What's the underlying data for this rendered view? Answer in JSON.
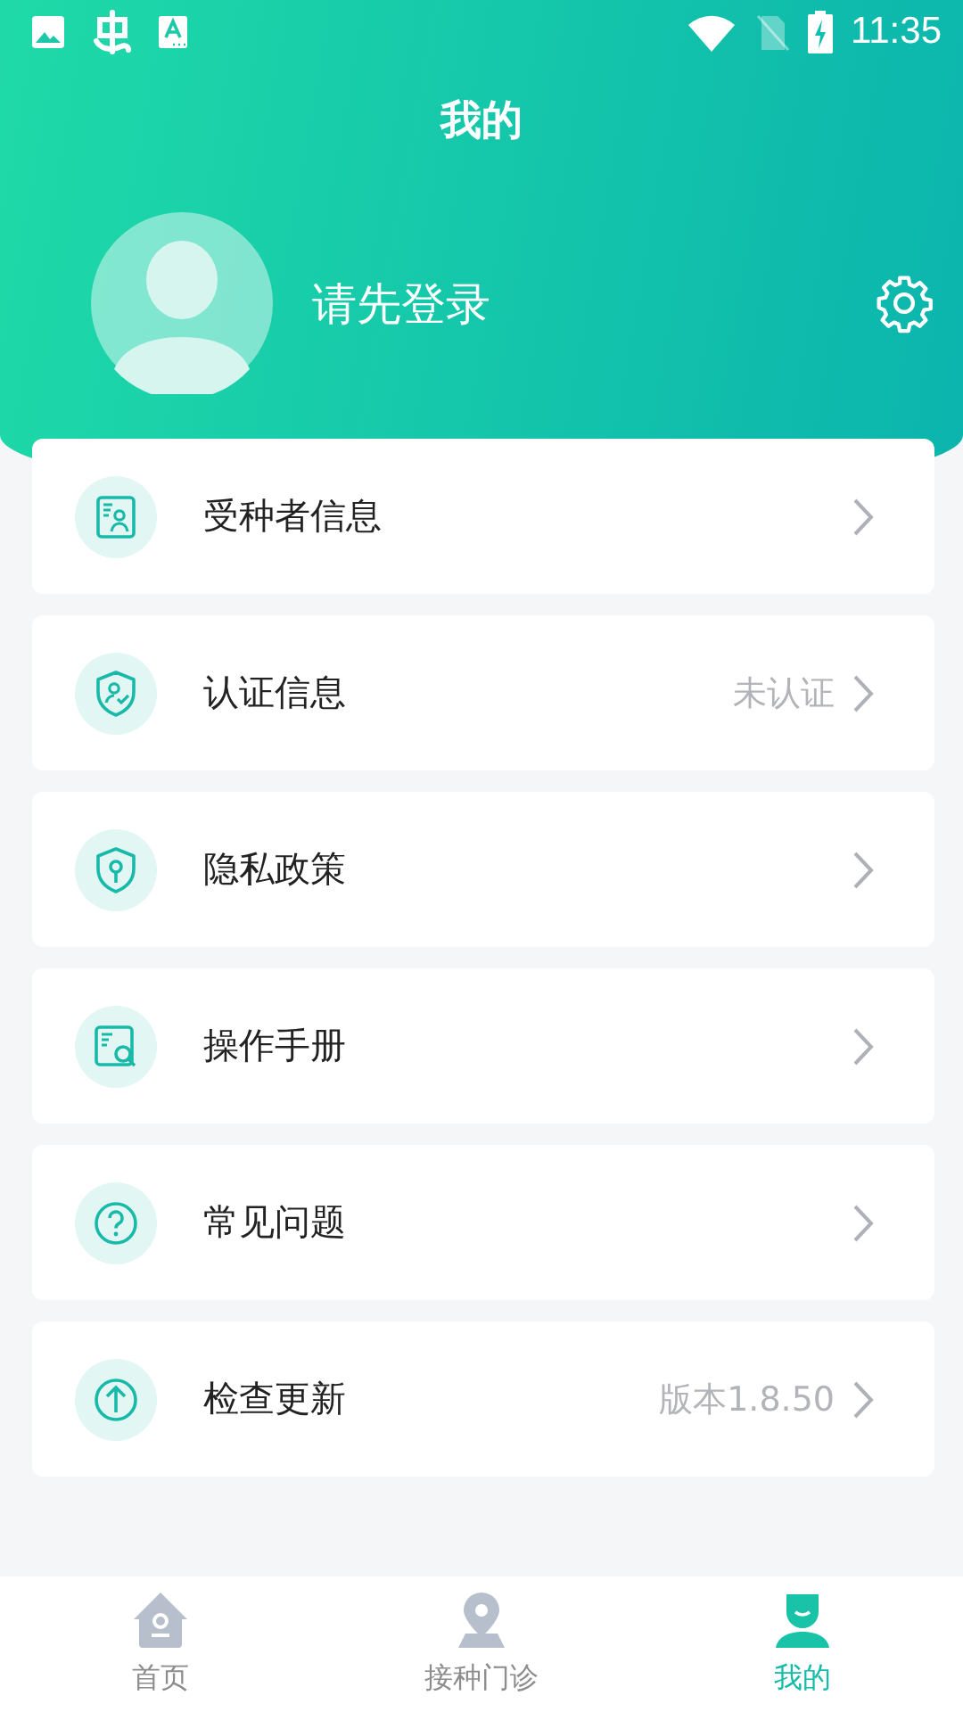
{
  "status_bar": {
    "time": "11:35"
  },
  "header": {
    "title": "我的",
    "login_prompt": "请先登录"
  },
  "menu": [
    {
      "label": "受种者信息"
    },
    {
      "label": "认证信息",
      "value": "未认证"
    },
    {
      "label": "隐私政策"
    },
    {
      "label": "操作手册"
    },
    {
      "label": "常见问题"
    },
    {
      "label": "检查更新",
      "value": "版本1.8.50"
    }
  ],
  "tab_bar": [
    {
      "label": "首页",
      "selected": false
    },
    {
      "label": "接种门诊",
      "selected": false
    },
    {
      "label": "我的",
      "selected": true
    }
  ]
}
